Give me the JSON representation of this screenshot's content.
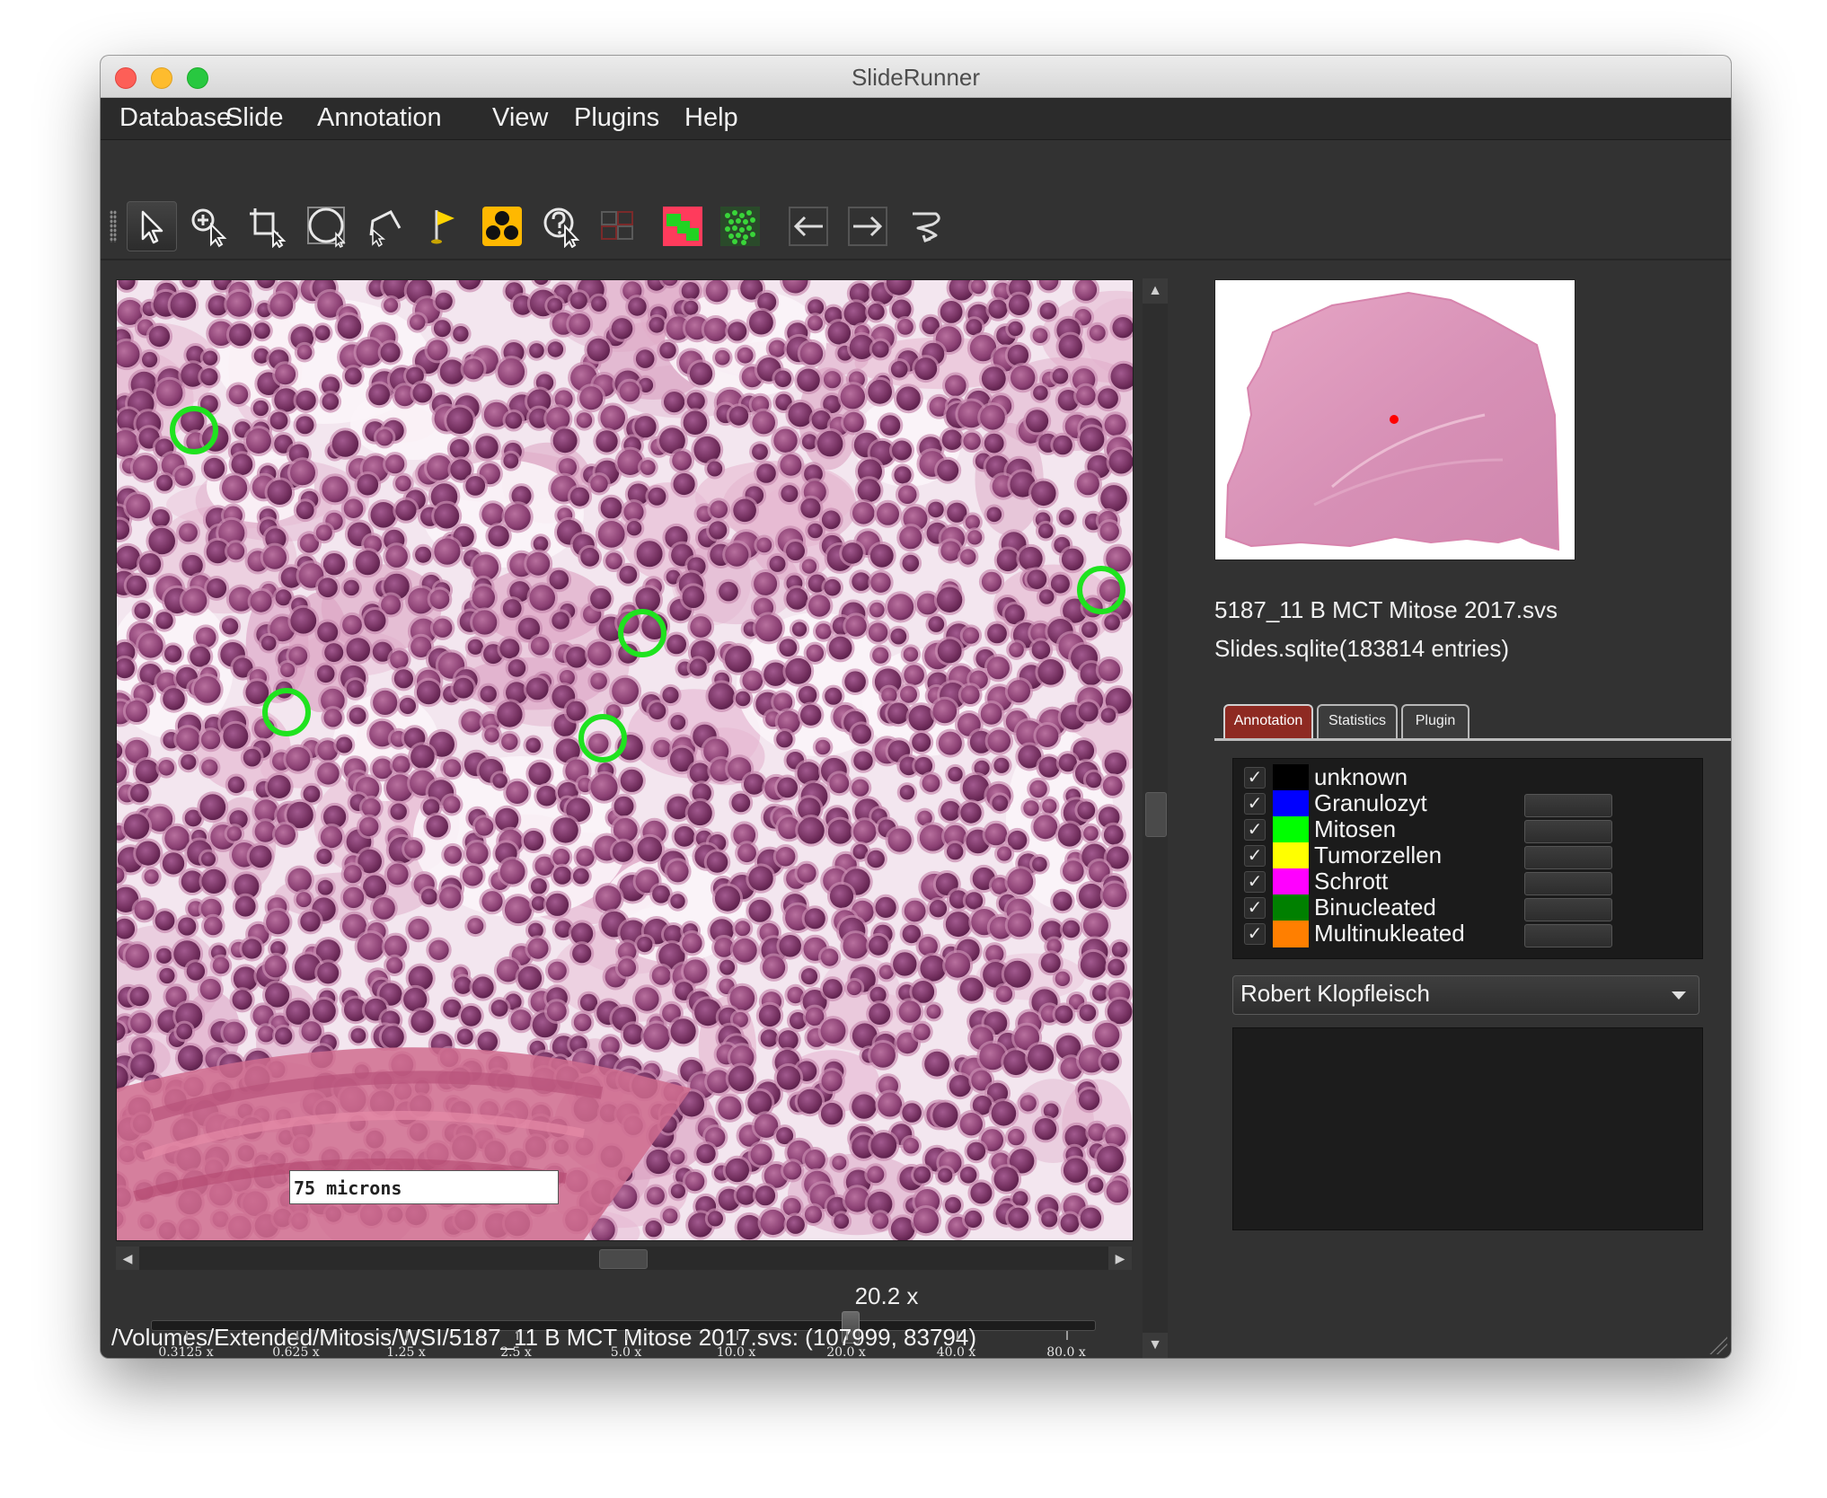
{
  "window": {
    "title": "SlideRunner"
  },
  "menu": [
    "Database",
    "Slide",
    "Annotation",
    "View",
    "Plugins",
    "Help"
  ],
  "toolbar": {
    "tools": [
      {
        "name": "select-tool-button",
        "icon": "pointer-icon"
      },
      {
        "name": "zoom-tool-button",
        "icon": "magnifier-pointer-icon"
      },
      {
        "name": "crop-tool-button",
        "icon": "crop-icon"
      },
      {
        "name": "circle-annotation-button",
        "icon": "circle-select-icon"
      },
      {
        "name": "polygon-annotation-button",
        "icon": "polygon-icon"
      },
      {
        "name": "flag-annotation-button",
        "icon": "flag-icon"
      },
      {
        "name": "screening-button",
        "icon": "three-dots-icon"
      },
      {
        "name": "query-tool-button",
        "icon": "question-pointer-icon"
      },
      {
        "name": "grid-tool-button",
        "icon": "grid-icon"
      },
      {
        "name": "overlay-button",
        "icon": "overlay-blocks-icon"
      },
      {
        "name": "heatmap-button",
        "icon": "cluster-icon"
      },
      {
        "name": "previous-button",
        "icon": "arrow-left-icon"
      },
      {
        "name": "next-button",
        "icon": "arrow-right-icon"
      },
      {
        "name": "back-button",
        "icon": "curved-back-icon"
      }
    ]
  },
  "viewer": {
    "scale_label": "75 microns",
    "zoom_value": "20.2 x",
    "zoom_level": 20.2,
    "zoom_ticks": [
      "0.3125 x",
      "0.625 x",
      "1.25 x",
      "2.5 x",
      "5.0 x",
      "10.0 x",
      "20.0 x",
      "40.0 x",
      "80.0 x"
    ]
  },
  "status": {
    "text": "/Volumes/Extended/Mitosis/WSI/5187_11 B MCT Mitose 2017.svs: (107999, 83794)"
  },
  "info": {
    "slide_name": "5187_11 B MCT Mitose 2017.svs",
    "database": "Slides.sqlite(183814 entries)"
  },
  "tabs": [
    "Annotation",
    "Statistics",
    "Plugin"
  ],
  "classes": [
    {
      "label": "unknown",
      "color": "#000000",
      "checked": true,
      "has_button": false
    },
    {
      "label": "Granulozyt",
      "color": "#0000ff",
      "checked": true,
      "has_button": true
    },
    {
      "label": "Mitosen",
      "color": "#00ff00",
      "checked": true,
      "has_button": true
    },
    {
      "label": "Tumorzellen",
      "color": "#ffff00",
      "checked": true,
      "has_button": true
    },
    {
      "label": "Schrott",
      "color": "#ff00ff",
      "checked": true,
      "has_button": true
    },
    {
      "label": "Binucleated",
      "color": "#008000",
      "checked": true,
      "has_button": true
    },
    {
      "label": "Multinukleated",
      "color": "#ff7f00",
      "checked": true,
      "has_button": true
    }
  ],
  "annotator": {
    "selected": "Robert Klopfleisch"
  },
  "colors": {
    "annotation_circle": "#1fe31f",
    "overview_marker": "#ff0000",
    "active_tab": "#8e2a22"
  }
}
